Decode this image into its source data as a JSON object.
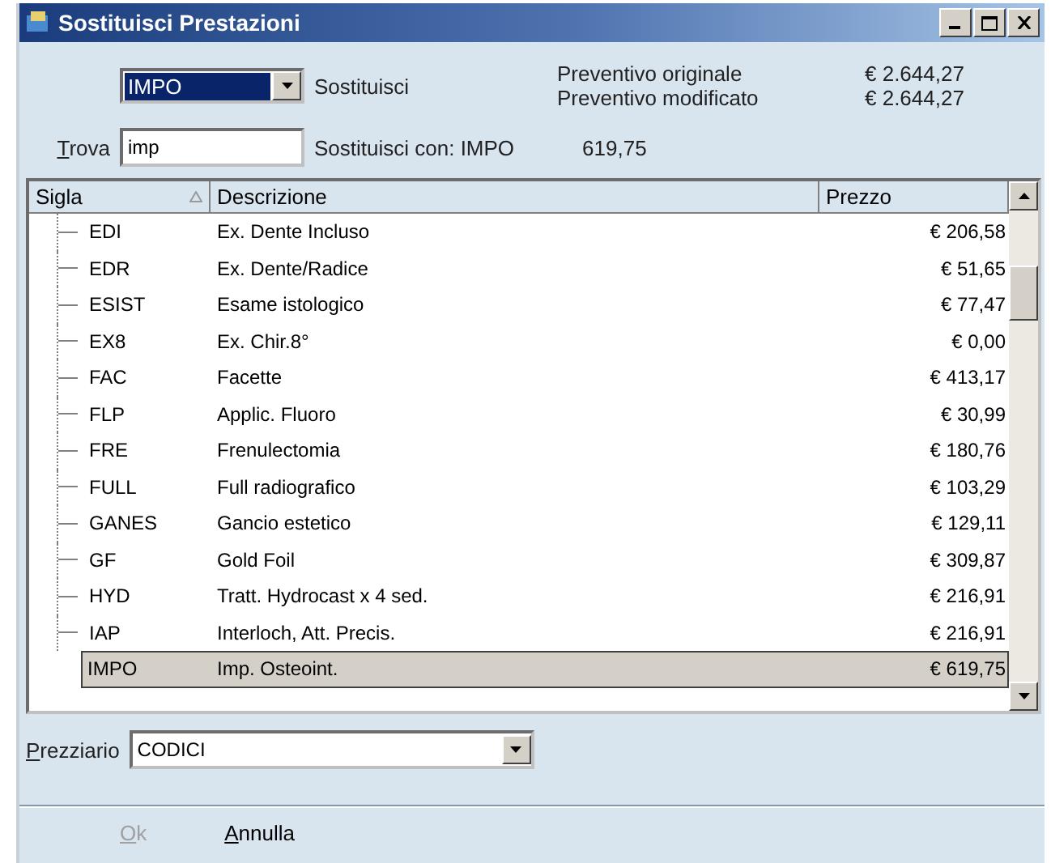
{
  "window": {
    "title": "Sostituisci Prestazioni"
  },
  "header": {
    "code_combo": {
      "value": "IMPO"
    },
    "replace_label": "Sostituisci",
    "summary": [
      {
        "label": "Preventivo originale",
        "value": "€ 2.644,27"
      },
      {
        "label": "Preventivo modificato",
        "value": "€ 2.644,27"
      }
    ],
    "find": {
      "label": "Trova",
      "value": "imp"
    },
    "replace_with": {
      "label": "Sostituisci con: IMPO",
      "value": "619,75"
    }
  },
  "table": {
    "columns": [
      {
        "label": "Sigla",
        "sorted": true
      },
      {
        "label": "Descrizione",
        "sorted": false
      },
      {
        "label": "Prezzo",
        "sorted": false
      }
    ],
    "rows": [
      {
        "code": "EDI",
        "description": "Ex. Dente Incluso",
        "price": "€ 206,58",
        "selected": false
      },
      {
        "code": "EDR",
        "description": "Ex. Dente/Radice",
        "price": "€ 51,65",
        "selected": false
      },
      {
        "code": "ESIST",
        "description": "Esame istologico",
        "price": "€ 77,47",
        "selected": false
      },
      {
        "code": "EX8",
        "description": "Ex. Chir.8°",
        "price": "€ 0,00",
        "selected": false
      },
      {
        "code": "FAC",
        "description": "Facette",
        "price": "€ 413,17",
        "selected": false
      },
      {
        "code": "FLP",
        "description": "Applic. Fluoro",
        "price": "€ 30,99",
        "selected": false
      },
      {
        "code": "FRE",
        "description": "Frenulectomia",
        "price": "€ 180,76",
        "selected": false
      },
      {
        "code": "FULL",
        "description": "Full radiografico",
        "price": "€ 103,29",
        "selected": false
      },
      {
        "code": "GANES",
        "description": "Gancio estetico",
        "price": "€ 129,11",
        "selected": false
      },
      {
        "code": "GF",
        "description": "Gold Foil",
        "price": "€ 309,87",
        "selected": false
      },
      {
        "code": "HYD",
        "description": "Tratt. Hydrocast x 4 sed.",
        "price": "€ 216,91",
        "selected": false
      },
      {
        "code": "IAP",
        "description": "Interloch, Att. Precis.",
        "price": "€ 216,91",
        "selected": false
      },
      {
        "code": "IMPO",
        "description": "Imp. Osteoint.",
        "price": "€ 619,75",
        "selected": true
      }
    ]
  },
  "price_list": {
    "label": "Prezziario",
    "value": "CODICI"
  },
  "buttons": [
    {
      "label": "Ok",
      "disabled": true
    },
    {
      "label": "Annulla",
      "disabled": false
    }
  ]
}
